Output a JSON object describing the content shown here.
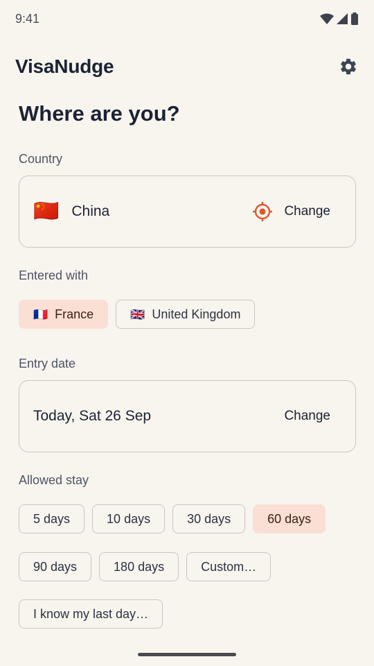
{
  "status_bar": {
    "time": "9:41"
  },
  "app_bar": {
    "title": "VisaNudge",
    "settings_icon": "gear-icon"
  },
  "heading": "Where are you?",
  "country": {
    "label": "Country",
    "flag": "🇨🇳",
    "value": "China",
    "change_label": "Change",
    "locate_icon": "location-target-icon",
    "accent_color": "#e0562b"
  },
  "entered_with": {
    "label": "Entered with",
    "options": [
      {
        "flag": "🇫🇷",
        "label": "France",
        "selected": true
      },
      {
        "flag": "🇬🇧",
        "label": "United Kingdom",
        "selected": false
      }
    ]
  },
  "entry_date": {
    "label": "Entry date",
    "value": "Today, Sat 26 Sep",
    "change_label": "Change"
  },
  "allowed_stay": {
    "label": "Allowed stay",
    "row1": [
      "5 days",
      "10 days",
      "30 days",
      "60 days"
    ],
    "row2": [
      "90 days",
      "180 days",
      "Custom…"
    ],
    "row3": [
      "I know my last day…"
    ],
    "selected": "60 days"
  },
  "colors": {
    "background": "#f8f5ef",
    "chip_selected": "#fadfd5",
    "border": "#c9c6c1",
    "text_primary": "#1b2233"
  }
}
